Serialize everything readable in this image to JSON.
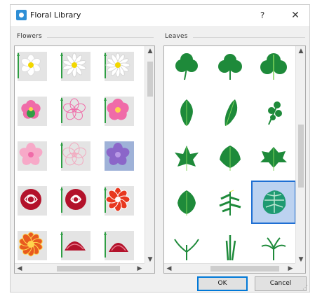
{
  "window": {
    "title": "Floral Library",
    "help_label": "?",
    "close_label": "✕",
    "icon": "library-app-icon"
  },
  "groups": {
    "flowers_label": "Flowers",
    "leaves_label": "Leaves"
  },
  "flowers": {
    "items": [
      {
        "name": "daisy-white"
      },
      {
        "name": "daisy-white-2"
      },
      {
        "name": "daisy-white-3"
      },
      {
        "name": "pink-blossom"
      },
      {
        "name": "pink-outline-flower"
      },
      {
        "name": "pink-round-flower"
      },
      {
        "name": "pink-cherry-blossom"
      },
      {
        "name": "cherry-blossom-outline"
      },
      {
        "name": "purple-cherry-blossom"
      },
      {
        "name": "red-rose"
      },
      {
        "name": "red-rose-outline"
      },
      {
        "name": "red-dahlia"
      },
      {
        "name": "orange-flower"
      },
      {
        "name": "red-peony"
      },
      {
        "name": "red-peony-2"
      }
    ],
    "selected_index": 8
  },
  "leaves": {
    "items": [
      {
        "name": "clover-leaf"
      },
      {
        "name": "trefoil-leaf"
      },
      {
        "name": "trefoil-leaf-2"
      },
      {
        "name": "oak-leaf"
      },
      {
        "name": "lobed-leaf"
      },
      {
        "name": "fern-sprig"
      },
      {
        "name": "maple-leaf-1"
      },
      {
        "name": "ivy-leaf"
      },
      {
        "name": "grape-leaf"
      },
      {
        "name": "chestnut-leaf"
      },
      {
        "name": "palm-sprig"
      },
      {
        "name": "monstera-leaf"
      },
      {
        "name": "grass-sprig"
      },
      {
        "name": "reed-sprig"
      },
      {
        "name": "palm-fan"
      }
    ],
    "selected_index": 11
  },
  "buttons": {
    "ok_label": "OK",
    "cancel_label": "Cancel"
  },
  "colors": {
    "accent": "#1f6fd3",
    "leaf_green": "#1e8a3a",
    "stem_green": "#2f9e44",
    "pink": "#f06ba8",
    "red": "#b3122b",
    "purple": "#8b66c9"
  }
}
